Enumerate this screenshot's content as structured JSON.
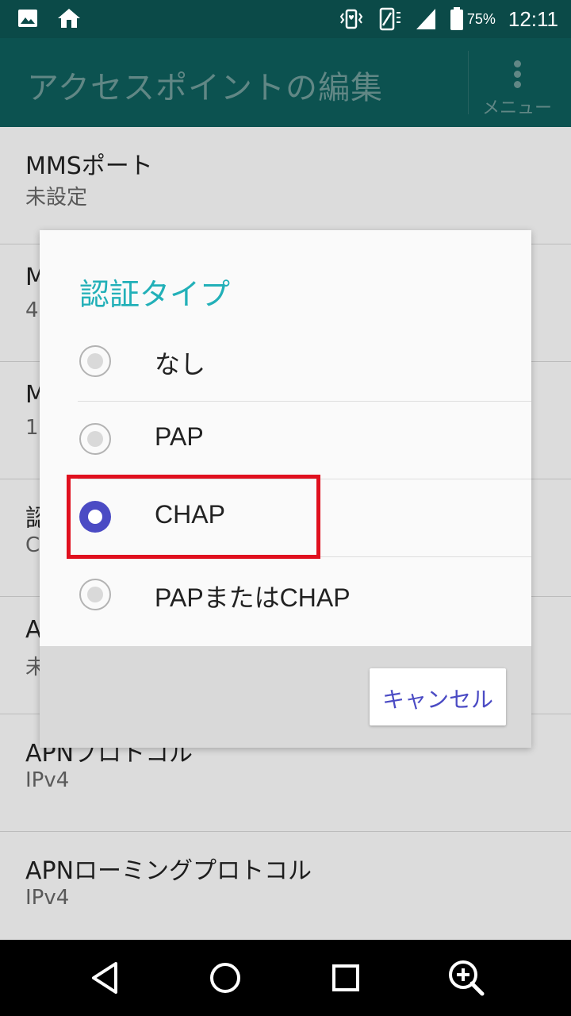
{
  "status_bar": {
    "battery_percent": "75%",
    "time": "12:11",
    "icons": [
      "image-icon",
      "home-icon",
      "vibrate-icon",
      "rotation-icon",
      "signal-icon",
      "battery-icon"
    ]
  },
  "action_bar": {
    "title": "アクセスポイントの編集",
    "menu_label": "メニュー"
  },
  "list": {
    "items": [
      {
        "title": "MMSポート",
        "subtitle": "未設定"
      },
      {
        "title": "M",
        "subtitle": "4"
      },
      {
        "title": "M",
        "subtitle": "1("
      },
      {
        "title": "認",
        "subtitle": "C"
      },
      {
        "title": "A",
        "subtitle": "未"
      },
      {
        "title": "APNプロトコル",
        "subtitle": "IPv4"
      },
      {
        "title": "APNローミングプロトコル",
        "subtitle": "IPv4"
      }
    ]
  },
  "dialog": {
    "title": "認証タイプ",
    "options": [
      {
        "label": "なし",
        "checked": false
      },
      {
        "label": "PAP",
        "checked": false
      },
      {
        "label": "CHAP",
        "checked": true
      },
      {
        "label": "PAPまたはCHAP",
        "checked": false
      }
    ],
    "cancel_label": "キャンセル"
  },
  "colors": {
    "accent": "#22b0b8",
    "radio_checked": "#4b4bc4",
    "highlight_box": "#e0101e",
    "action_bar": "#0e5e5c"
  },
  "nav_bar": {
    "icons": [
      "back-icon",
      "home-circle-icon",
      "recents-icon",
      "zoom-in-icon"
    ]
  }
}
